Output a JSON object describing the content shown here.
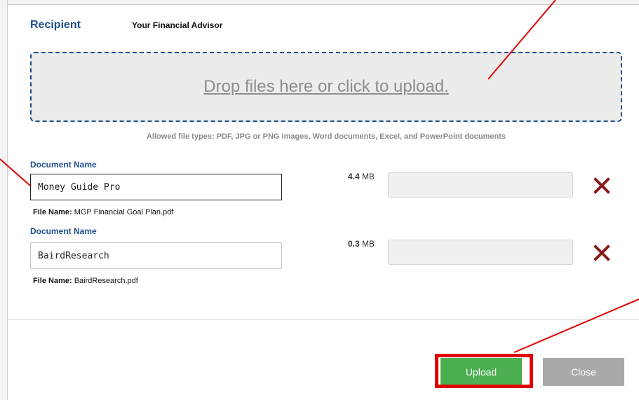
{
  "recipient": {
    "label": "Recipient",
    "value": "Your Financial Advisor"
  },
  "dropzone": {
    "text": "Drop files here or click to upload.",
    "allowed_types": "Allowed file types: PDF, JPG or PNG images, Word documents, Excel, and PowerPoint documents"
  },
  "documents": [
    {
      "label": "Document Name",
      "name_value": "Money Guide Pro",
      "file_name_label": "File Name:",
      "file_name": "MGP Financial Goal Plan.pdf",
      "size_value": "4.4",
      "size_unit": "MB",
      "remove_icon": "close-x-icon"
    },
    {
      "label": "Document Name",
      "name_value": "BairdResearch",
      "file_name_label": "File Name:",
      "file_name": "BairdResearch.pdf",
      "size_value": "0.3",
      "size_unit": "MB",
      "remove_icon": "close-x-icon"
    }
  ],
  "buttons": {
    "upload": "Upload",
    "close": "Close"
  },
  "colors": {
    "accent_blue": "#1f4f8f",
    "upload_green": "#4caf50",
    "close_gray": "#a9a9a9",
    "remove_red": "#8b1a1a",
    "annotation_red": "#e00000"
  }
}
